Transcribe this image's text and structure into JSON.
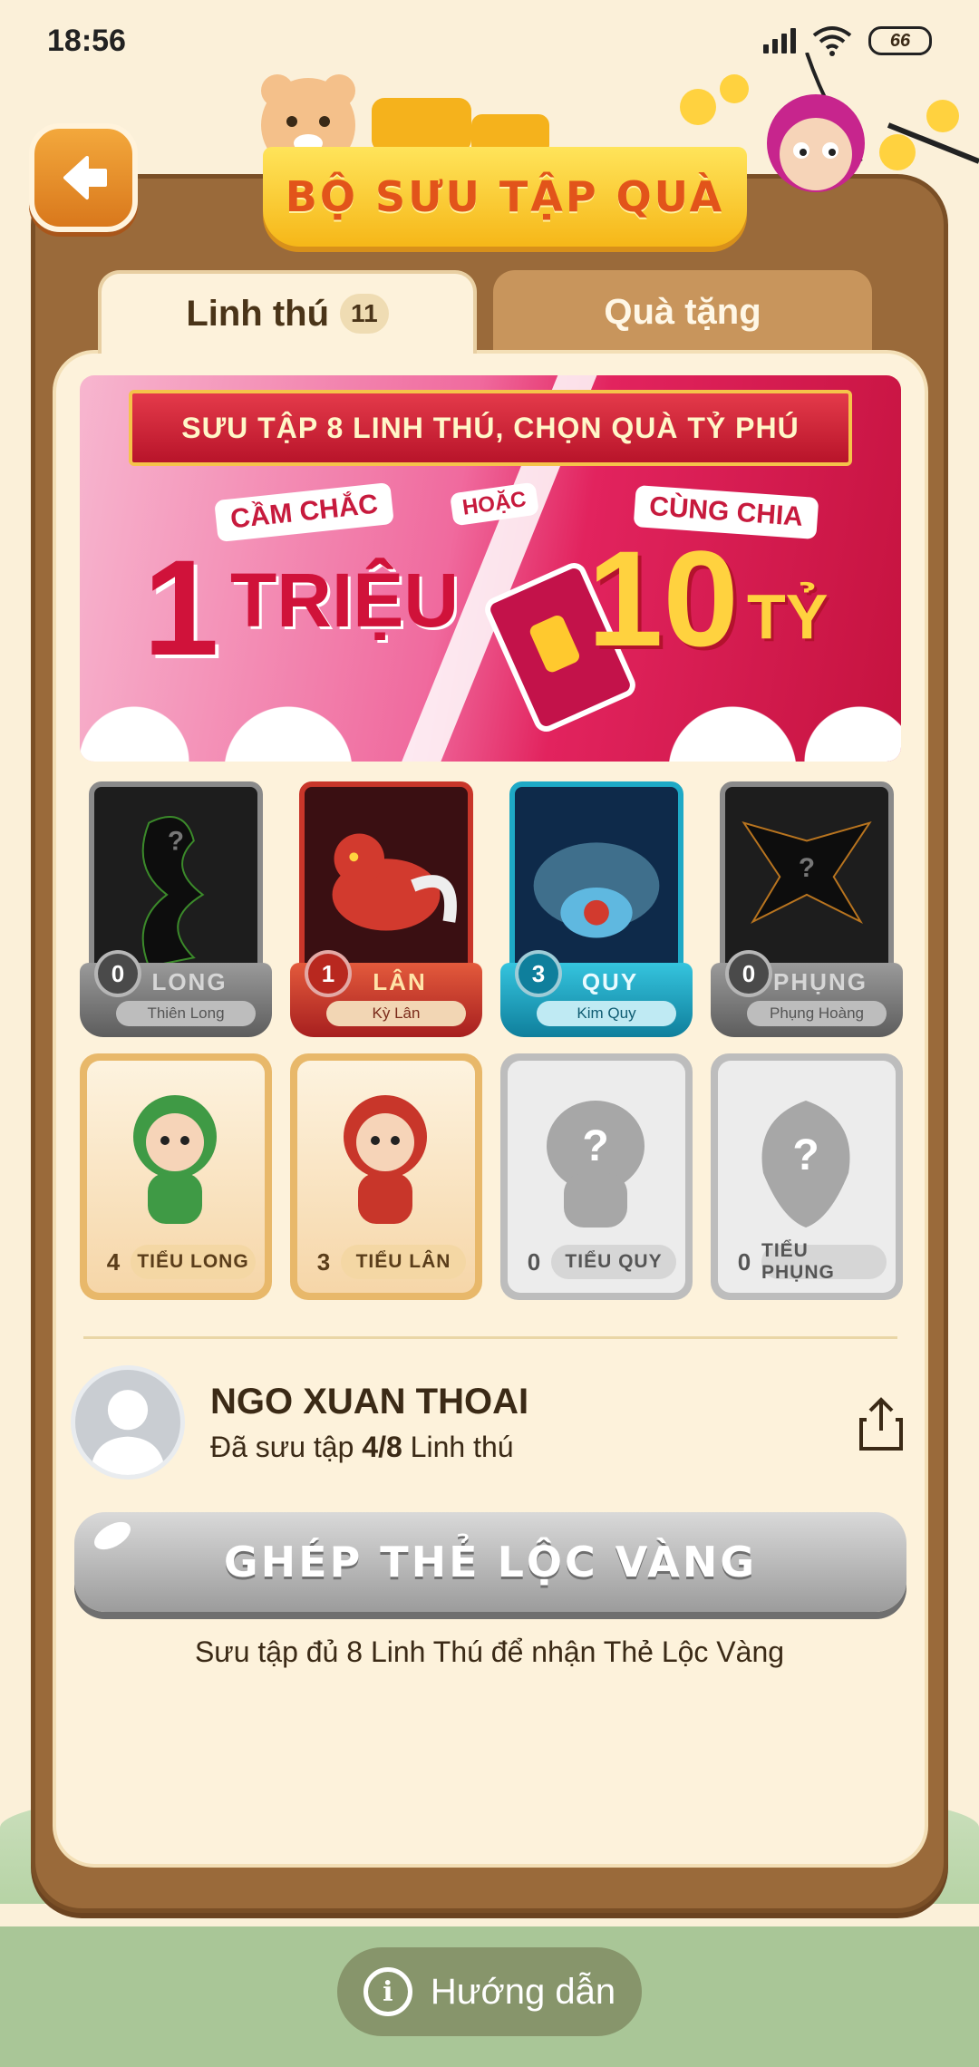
{
  "status_bar": {
    "time": "18:56",
    "battery": "66"
  },
  "header": {
    "title": "BỘ SƯU TẬP QUÀ",
    "back_icon": "back-arrow-icon"
  },
  "tabs": [
    {
      "label": "Linh thú",
      "count": "11",
      "active": true
    },
    {
      "label": "Quà tặng",
      "active": false
    }
  ],
  "promo": {
    "headline": "SƯU TẬP 8 LINH THÚ, CHỌN QUÀ TỶ PHÚ",
    "left_tag": "CẦM CHẮC",
    "left_big": "1",
    "left_unit": "TRIỆU",
    "or_tag": "HOẶC",
    "right_tag": "CÙNG CHIA",
    "right_big": "10",
    "right_unit": "TỶ"
  },
  "guardians": [
    {
      "count": "0",
      "name": "LONG",
      "sub": "Thiên Long",
      "locked": true,
      "color": "#5b5b5b"
    },
    {
      "count": "1",
      "name": "LÂN",
      "sub": "Kỳ Lân",
      "locked": false,
      "color": "#c8362a"
    },
    {
      "count": "3",
      "name": "QUY",
      "sub": "Kim Quy",
      "locked": false,
      "color": "#1ea9c6"
    },
    {
      "count": "0",
      "name": "PHỤNG",
      "sub": "Phụng Hoàng",
      "locked": true,
      "color": "#5b5b5b"
    }
  ],
  "babies": [
    {
      "count": "4",
      "label": "TIỂU LONG",
      "locked": false
    },
    {
      "count": "3",
      "label": "TIỂU LÂN",
      "locked": false
    },
    {
      "count": "0",
      "label": "TIỂU QUY",
      "locked": true
    },
    {
      "count": "0",
      "label": "TIỂU PHỤNG",
      "locked": true
    }
  ],
  "user": {
    "name": "NGO XUAN THOAI",
    "progress_prefix": "Đã sưu tập",
    "progress": "4/8",
    "progress_suffix": "Linh thú"
  },
  "combine_button": "GHÉP THẺ LỘC VÀNG",
  "combine_hint": "Sưu tập đủ 8 Linh Thú để nhận Thẻ Lộc Vàng",
  "guide_button": "Hướng dẫn"
}
